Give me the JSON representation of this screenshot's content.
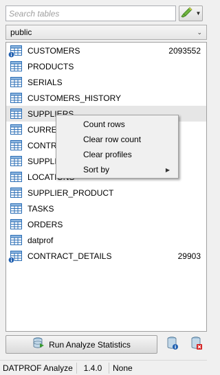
{
  "search": {
    "placeholder": "Search tables",
    "value": ""
  },
  "filter_button": {
    "icon": "filter-edit-icon"
  },
  "schema_select": {
    "selected": "public"
  },
  "tables": [
    {
      "name": "CUSTOMERS",
      "count": "2093552",
      "icon": "table-info-icon"
    },
    {
      "name": "PRODUCTS",
      "count": "",
      "icon": "table-icon"
    },
    {
      "name": "SERIALS",
      "count": "",
      "icon": "table-icon"
    },
    {
      "name": "CUSTOMERS_HISTORY",
      "count": "",
      "icon": "table-icon"
    },
    {
      "name": "SUPPLIERS",
      "count": "",
      "icon": "table-icon"
    },
    {
      "name": "CURRENCY",
      "count": "",
      "icon": "table-icon"
    },
    {
      "name": "CONTRACTS",
      "count": "",
      "icon": "table-icon"
    },
    {
      "name": "SUPPLIER_ORDERS",
      "count": "",
      "icon": "table-icon"
    },
    {
      "name": "LOCATIONS",
      "count": "",
      "icon": "table-icon"
    },
    {
      "name": "SUPPLIER_PRODUCT",
      "count": "",
      "icon": "table-icon"
    },
    {
      "name": "TASKS",
      "count": "",
      "icon": "table-icon"
    },
    {
      "name": "ORDERS",
      "count": "",
      "icon": "table-icon"
    },
    {
      "name": "datprof",
      "count": "",
      "icon": "table-icon"
    },
    {
      "name": "CONTRACT_DETAILS",
      "count": "29903",
      "icon": "table-info-icon"
    }
  ],
  "context_menu": {
    "items": [
      {
        "label": "Count rows"
      },
      {
        "label": "Clear row count"
      },
      {
        "label": "Clear profiles"
      },
      {
        "label": "Sort by",
        "submenu": true
      }
    ]
  },
  "toolbar": {
    "run_label": "Run Analyze Statistics",
    "run_icon": "analyze-database-icon",
    "db_info_icon": "database-info-icon",
    "db_delete_icon": "database-delete-icon"
  },
  "status": {
    "app_name": "DATPROF Analyze",
    "version": "1.4.0",
    "state": "None"
  },
  "colors": {
    "table_icon_blue": "#2a6db5",
    "info_badge": "#1f5fb0",
    "delete_red": "#d32020",
    "selected_row": "#e6e6e6"
  }
}
